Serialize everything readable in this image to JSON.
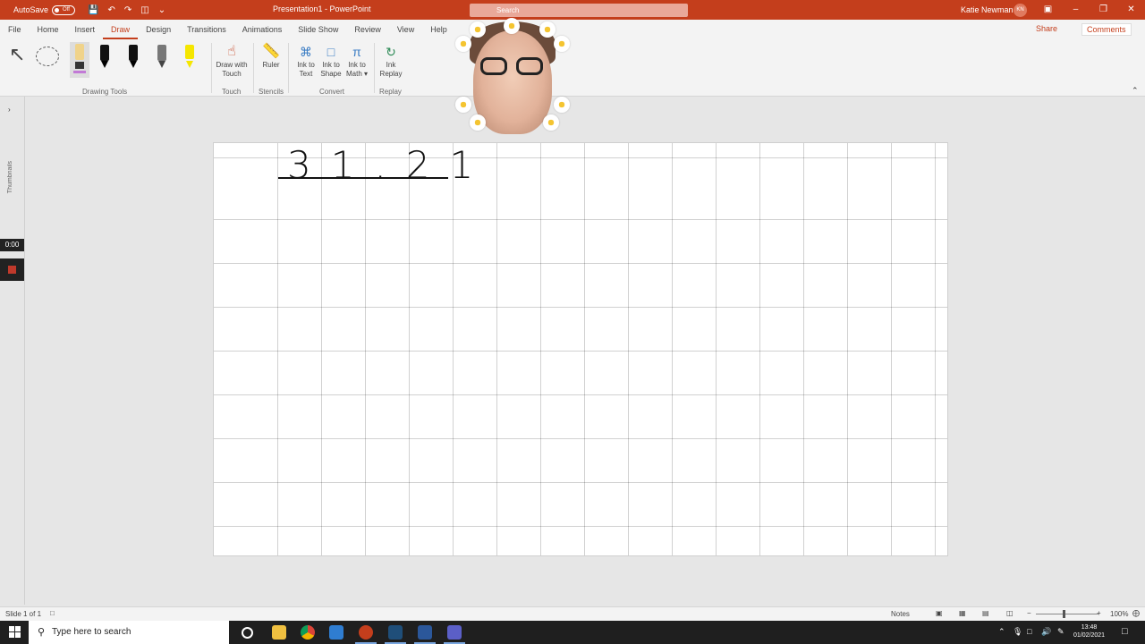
{
  "titlebar": {
    "autosave_label": "AutoSave",
    "autosave_state": "Off",
    "doc_title": "Presentation1 - PowerPoint",
    "search_placeholder": "Search",
    "user_name": "Katie Newman",
    "user_initials": "KN"
  },
  "tabs": [
    "File",
    "Home",
    "Insert",
    "Draw",
    "Design",
    "Transitions",
    "Animations",
    "Slide Show",
    "Review",
    "View",
    "Help"
  ],
  "active_tab": "Draw",
  "share_label": "Share",
  "comments_label": "Comments",
  "ribbon": {
    "groups": {
      "drawing_tools": "Drawing Tools",
      "touch": "Touch",
      "stencils": "Stencils",
      "convert": "Convert",
      "replay": "Replay"
    },
    "buttons": {
      "draw_with_touch_1": "Draw with",
      "draw_with_touch_2": "Touch",
      "ruler": "Ruler",
      "ink_to_text_1": "Ink to",
      "ink_to_text_2": "Text",
      "ink_to_shape_1": "Ink to",
      "ink_to_shape_2": "Shape",
      "ink_to_math_1": "Ink to",
      "ink_to_math_2": "Math ▾",
      "ink_replay_1": "Ink",
      "ink_replay_2": "Replay"
    },
    "pen_colors": [
      "#000000",
      "#000000",
      "#555555",
      "#f5e600"
    ]
  },
  "left_pane": {
    "thumbnails_label": "Thumbnails",
    "recording_time": "0:00"
  },
  "slide": {
    "handwriting": "31.21"
  },
  "statusbar": {
    "slide_count": "Slide 1 of 1",
    "notes_label": "Notes",
    "zoom": "100%"
  },
  "taskbar": {
    "search_placeholder": "Type here to search",
    "time": "13:48",
    "date": "01/02/2021"
  }
}
